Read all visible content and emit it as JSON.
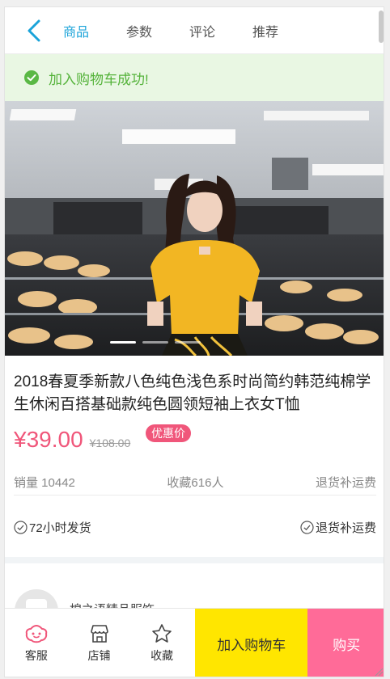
{
  "header": {
    "tabs": [
      {
        "label": "商品",
        "active": true
      },
      {
        "label": "参数",
        "active": false
      },
      {
        "label": "评论",
        "active": false
      },
      {
        "label": "推荐",
        "active": false
      }
    ]
  },
  "toast": {
    "message": "加入购物车成功!"
  },
  "product": {
    "title": "2018春夏季新款八色纯色浅色系时尚简约韩范纯棉学生休闲百搭基础款纯色圆领短袖上衣女T恤",
    "price": "¥39.00",
    "original_price": "¥108.00",
    "promo_badge": "优惠价",
    "image_count": 3,
    "current_image": 1
  },
  "stats": {
    "sales": "销量 10442",
    "favorites": "收藏616人",
    "returns": "退货补运费"
  },
  "guarantees": {
    "shipping": "72小时发货",
    "returns": "退货补运费"
  },
  "shop": {
    "name": "棉之语精品服饰"
  },
  "bottom_bar": {
    "service": "客服",
    "store": "店铺",
    "favorite": "收藏",
    "add_to_cart": "加入购物车",
    "buy": "购买"
  },
  "colors": {
    "accent_tab": "#1aa3d9",
    "price": "#f0567a",
    "cart_button": "#ffe600",
    "buy_button": "#ff6b98",
    "toast_bg": "#e9f7e3",
    "toast_text": "#55b33b"
  }
}
